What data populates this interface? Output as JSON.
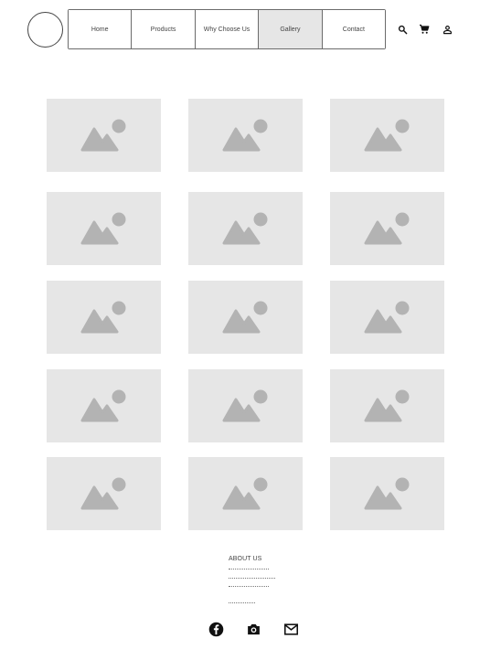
{
  "header": {
    "logo": "logo-circle",
    "nav": [
      {
        "label": "Home",
        "active": false
      },
      {
        "label": "Products",
        "active": false
      },
      {
        "label": "Why Choose Us",
        "active": false
      },
      {
        "label": "Gallery",
        "active": true
      },
      {
        "label": "Contact",
        "active": false
      }
    ],
    "icons": [
      "search-icon",
      "cart-icon",
      "account-icon"
    ]
  },
  "gallery": {
    "rows": 5,
    "columns": 3,
    "placeholder_icon": "image-placeholder-icon",
    "placeholder_color": "#e6e6e6",
    "icon_color": "#b3b3b3"
  },
  "footer": {
    "about_title": "ABOUT US",
    "social": [
      "facebook-icon",
      "camera-icon",
      "mail-icon"
    ]
  }
}
